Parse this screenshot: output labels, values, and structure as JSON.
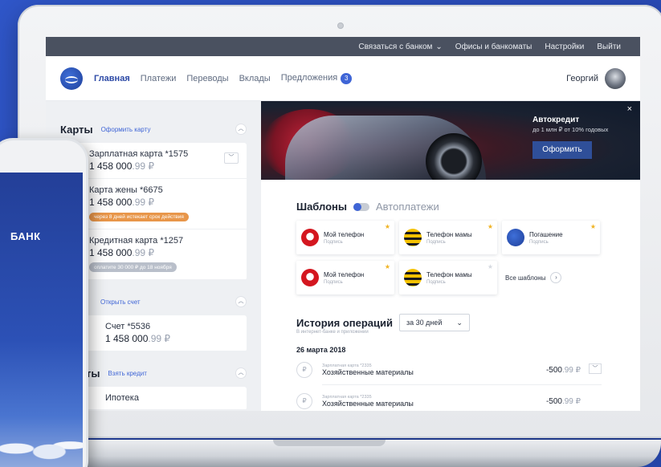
{
  "topbar": {
    "contact": "Связаться с банком",
    "offices": "Офисы и банкоматы",
    "settings": "Настройки",
    "logout": "Выйти"
  },
  "nav": {
    "items": [
      "Главная",
      "Платежи",
      "Переводы",
      "Вклады",
      "Предложения"
    ],
    "offers_badge": "3",
    "user_name": "Георгий"
  },
  "sidebar": {
    "cards_title": "Карты",
    "cards_link": "Оформить карту",
    "cards": [
      {
        "name": "Зарплатная карта *1575",
        "amount": "1 458 000",
        "cents": ".99 ₽",
        "note": ""
      },
      {
        "name": "Карта жены *6675",
        "amount": "1 458 000",
        "cents": ".99 ₽",
        "note": "через 8 дней истекает срок действия"
      },
      {
        "name": "Кредитная карта *1257",
        "amount": "1 458 000",
        "cents": ".99 ₽",
        "note": "оплатите 30 000 ₽ до 18 ноября"
      }
    ],
    "accounts_link": "Открыть счет",
    "account": {
      "name": "Счет *5536",
      "amount": "1 458 000",
      "cents": ".99 ₽"
    },
    "credits_title": "ты",
    "credits_link": "Взять кредит",
    "credit": {
      "name": "Ипотека"
    }
  },
  "banner": {
    "title": "Автокредит",
    "subtitle": "до 1 млн ₽ от 10% годовых",
    "button": "Оформить",
    "close": "×"
  },
  "templates": {
    "title": "Шаблоны",
    "alt": "Автоплатежи",
    "items": [
      {
        "name": "Мой телефон",
        "sub": "Подпись",
        "icon": "mts-icon"
      },
      {
        "name": "Телефон мамы",
        "sub": "Подпись",
        "icon": "beeline-icon"
      },
      {
        "name": "Погашение",
        "sub": "Подпись",
        "icon": "bank-icon"
      },
      {
        "name": "Мой телефон",
        "sub": "Подпись",
        "icon": "mts-icon"
      },
      {
        "name": "Телефон мамы",
        "sub": "Подпись",
        "icon": "beeline-icon"
      }
    ],
    "all": "Все шаблоны"
  },
  "history": {
    "title": "История операций",
    "period": "за 30 дней",
    "note": "В интернет-банке и приложении",
    "date": "26 марта 2018",
    "ops": [
      {
        "card": "Зарплатная карта *2335",
        "name": "Хозяйственные материалы",
        "amount": "-500",
        "cents": ".99 ₽"
      },
      {
        "card": "Зарплатная карта *2335",
        "name": "Хозяйственные материалы",
        "amount": "-500",
        "cents": ".99 ₽"
      }
    ]
  },
  "phone": {
    "text": "БАНК"
  },
  "colors": {
    "accent": "#3f65d6",
    "topbar": "#4a5160",
    "background": "#2f56c8"
  }
}
